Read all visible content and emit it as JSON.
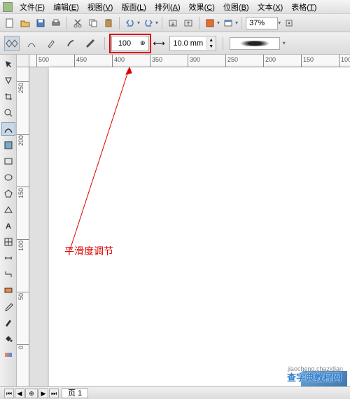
{
  "menu": {
    "file": "文件",
    "file_k": "F",
    "edit": "编辑",
    "edit_k": "E",
    "view": "视图",
    "view_k": "V",
    "layout": "版面",
    "layout_k": "L",
    "arrange": "排列",
    "arrange_k": "A",
    "effects": "效果",
    "effects_k": "C",
    "bitmap": "位图",
    "bitmap_k": "B",
    "text": "文本",
    "text_k": "X",
    "table": "表格",
    "table_k": "T"
  },
  "toolbar": {
    "zoom": "37%"
  },
  "options": {
    "smoothness": "100",
    "dimension": "10.0 mm"
  },
  "ruler_h": [
    "500",
    "450",
    "400",
    "350",
    "300",
    "250",
    "200",
    "150",
    "100"
  ],
  "ruler_v": [
    "250",
    "200",
    "150",
    "100",
    "50",
    "0"
  ],
  "annotation": "平滑度调节",
  "status": {
    "page_label": "页 1"
  },
  "watermark": "查字典教程网",
  "watermark_url": "jiaocheng.chazidian"
}
